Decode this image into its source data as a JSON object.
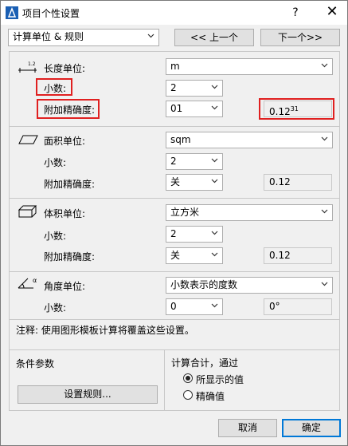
{
  "window": {
    "title": "项目个性设置",
    "help": "?",
    "close": "✕"
  },
  "nav": {
    "category": "计算单位 & 规则",
    "prev": "<< 上一个",
    "next": "下一个>>"
  },
  "length": {
    "label": "长度单位:",
    "unit": "m",
    "decimals_label": "小数:",
    "decimals": "2",
    "precision_label": "附加精确度:",
    "precision": "01",
    "preview": "0.12",
    "preview_sup": "31"
  },
  "area": {
    "label": "面积单位:",
    "unit": "sqm",
    "decimals_label": "小数:",
    "decimals": "2",
    "precision_label": "附加精确度:",
    "precision": "关",
    "preview": "0.12"
  },
  "volume": {
    "label": "体积单位:",
    "unit": "立方米",
    "decimals_label": "小数:",
    "decimals": "2",
    "precision_label": "附加精确度:",
    "precision": "关",
    "preview": "0.12"
  },
  "angle": {
    "label": "角度单位:",
    "unit": "小数表示的度数",
    "decimals_label": "小数:",
    "decimals": "0",
    "preview": "0°"
  },
  "note": "注释: 使用图形模板计算将覆盖这些设置。",
  "conditions": {
    "label": "条件参数",
    "rules_button": "设置规则..."
  },
  "calc": {
    "label": "计算合计，通过",
    "option1": "所显示的值",
    "option2": "精确值"
  },
  "footer": {
    "cancel": "取消",
    "ok": "确定"
  }
}
